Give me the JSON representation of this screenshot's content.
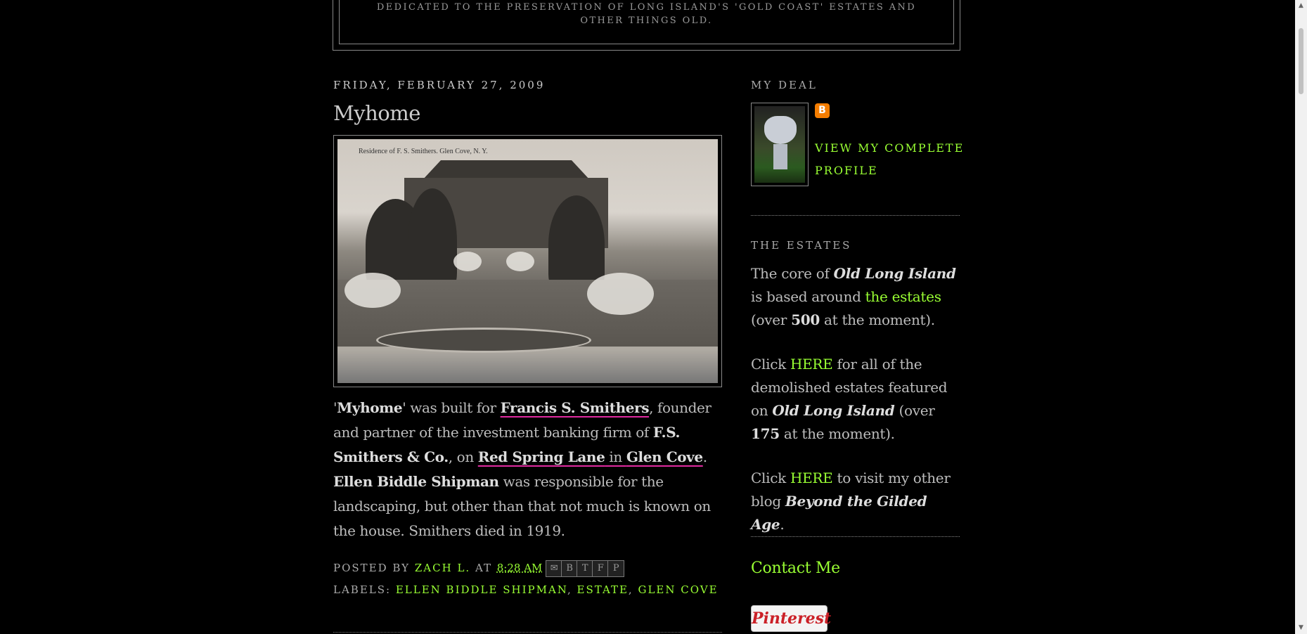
{
  "header": {
    "description": "Dedicated to the preservation of Long Island's 'Gold Coast' estates and other things old."
  },
  "post": {
    "date": "Friday, February 27, 2009",
    "title": "Myhome",
    "photo_caption": "Residence of F. S. Smithers.      Glen Cove, N. Y.",
    "body": {
      "quote_open": "'",
      "name": "Myhome",
      "quote_close": "' was built for ",
      "link_smithers": "Francis S. Smithers",
      "t1": ", founder and partner of the investment banking firm of ",
      "firm": "F.S. Smithers & Co.",
      "t2": ", on ",
      "link_lane": "Red Spring Lane",
      "t3": " in ",
      "link_glencove": "Glen Cove",
      "t4": ". ",
      "landscaper": "Ellen Biddle Shipman",
      "t5": " was responsible for the landscaping, but other than that not much is known on the house. Smithers died in 1919."
    },
    "posted_by_label": "Posted by",
    "author": "Zach L.",
    "at_label": "at",
    "time": "8:28 AM",
    "labels_label": "Labels:",
    "labels": [
      "Ellen Biddle Shipman",
      "Estate",
      "Glen Cove"
    ],
    "share_icons": [
      "email-icon",
      "blogger-icon",
      "twitter-icon",
      "facebook-icon",
      "pinterest-icon"
    ]
  },
  "sidebar": {
    "my_deal_title": "My Deal",
    "profile_link": "View my complete profile",
    "estates_title": "The Estates",
    "estates": {
      "p1_a": "The core of ",
      "p1_b": "Old Long Island",
      "p1_c": " is based around ",
      "p1_link": "the estates",
      "p1_d": " (over ",
      "p1_num": "500",
      "p1_e": " at the moment).",
      "p2_a": "Click ",
      "p2_link": "HERE",
      "p2_b": " for all of the demolished estates featured on ",
      "p2_c": "Old Long Island",
      "p2_d": " (over ",
      "p2_num": "175",
      "p2_e": " at the moment).",
      "p3_a": "Click ",
      "p3_link": "HERE",
      "p3_b": " to visit my other blog ",
      "p3_c": "Beyond the Gilded Age",
      "p3_d": "."
    },
    "contact": "Contact Me",
    "pinterest_button": "Pinterest"
  },
  "colors": {
    "background": "#000000",
    "link": "#99ff33",
    "text": "#bdbdbd",
    "underline_annotation": "#e02aa0"
  }
}
